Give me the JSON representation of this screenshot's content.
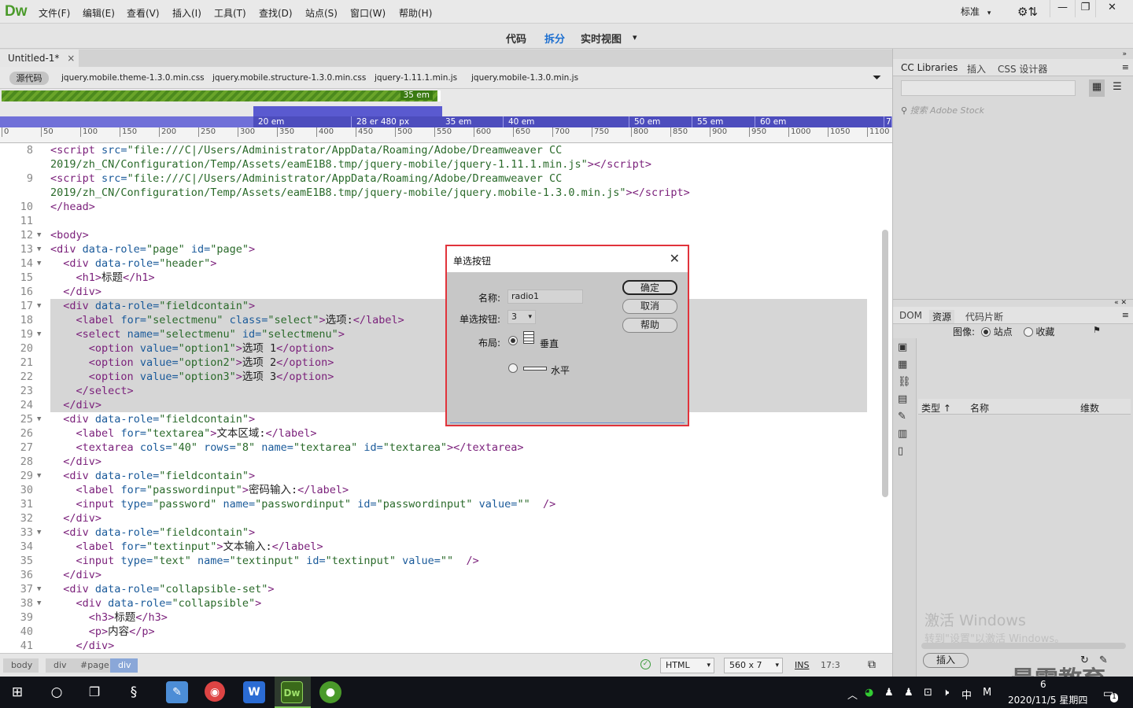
{
  "app": {
    "logo": "Dw",
    "menu": [
      "文件(F)",
      "编辑(E)",
      "查看(V)",
      "插入(I)",
      "工具(T)",
      "查找(D)",
      "站点(S)",
      "窗口(W)",
      "帮助(H)"
    ],
    "workspace": "标准",
    "workspace_caret": "▾",
    "window_minimize": "—",
    "window_restore": "❐",
    "window_close": "✕"
  },
  "view_toolbar": {
    "code": "代码",
    "split": "拆分",
    "live": "实时视图",
    "live_caret": "▾"
  },
  "document": {
    "tab_label": "Untitled-1*",
    "tab_close": "×",
    "source_button": "源代码",
    "related_files": [
      "jquery.mobile.theme-1.3.0.min.css",
      "jquery.mobile.structure-1.3.0.min.css",
      "jquery-1.11.1.min.js",
      "jquery.mobile-1.3.0.min.js"
    ]
  },
  "media_queries": {
    "green_label": "35  em",
    "row3_labels": [
      "20  em",
      "28  er 480  px",
      "35  em",
      "40  em",
      "50  em",
      "55  em",
      "60  em",
      "7"
    ],
    "ruler_ticks": [
      "0",
      "50",
      "100",
      "150",
      "200",
      "250",
      "300",
      "350",
      "400",
      "450",
      "500",
      "550",
      "600",
      "650",
      "700",
      "750",
      "800",
      "850",
      "900",
      "950",
      "1000",
      "1050",
      "1100"
    ]
  },
  "code_lines": [
    {
      "n": "8",
      "fold": "",
      "hl": false,
      "html": "<span class='tag'>&lt;script</span> <span class='attr'>src=</span><span class='val'>\"file:///C|/Users/Administrator/AppData/Roaming/Adobe/Dreamweaver CC</span>"
    },
    {
      "n": "",
      "fold": "",
      "hl": false,
      "html": "<span class='val'>2019/zh_CN/Configuration/Temp/Assets/eamE1B8.tmp/jquery-mobile/jquery-1.11.1.min.js\"</span><span class='tag'>&gt;&lt;/script&gt;</span>"
    },
    {
      "n": "9",
      "fold": "",
      "hl": false,
      "html": "<span class='tag'>&lt;script</span> <span class='attr'>src=</span><span class='val'>\"file:///C|/Users/Administrator/AppData/Roaming/Adobe/Dreamweaver CC</span>"
    },
    {
      "n": "",
      "fold": "",
      "hl": false,
      "html": "<span class='val'>2019/zh_CN/Configuration/Temp/Assets/eamE1B8.tmp/jquery-mobile/jquery.mobile-1.3.0.min.js\"</span><span class='tag'>&gt;&lt;/script&gt;</span>"
    },
    {
      "n": "10",
      "fold": "",
      "hl": false,
      "html": "<span class='tag'>&lt;/head&gt;</span>"
    },
    {
      "n": "11",
      "fold": "",
      "hl": false,
      "html": ""
    },
    {
      "n": "12",
      "fold": "▼",
      "hl": false,
      "html": "<span class='tag'>&lt;body&gt;</span>"
    },
    {
      "n": "13",
      "fold": "▼",
      "hl": false,
      "html": "<span class='tag'>&lt;div</span> <span class='attr'>data-role=</span><span class='val'>\"page\"</span> <span class='attr'>id=</span><span class='val'>\"page\"</span><span class='tag'>&gt;</span>"
    },
    {
      "n": "14",
      "fold": "▼",
      "hl": false,
      "html": "  <span class='tag'>&lt;div</span> <span class='attr'>data-role=</span><span class='val'>\"header\"</span><span class='tag'>&gt;</span>"
    },
    {
      "n": "15",
      "fold": "",
      "hl": false,
      "html": "    <span class='tag'>&lt;h1&gt;</span>标题<span class='tag'>&lt;/h1&gt;</span>"
    },
    {
      "n": "16",
      "fold": "",
      "hl": false,
      "html": "  <span class='tag'>&lt;/div&gt;</span>"
    },
    {
      "n": "17",
      "fold": "▼",
      "hl": true,
      "html": "  <span class='tag'>&lt;div</span> <span class='attr'>data-role=</span><span class='val'>\"fieldcontain\"</span><span class='tag'>&gt;</span>"
    },
    {
      "n": "18",
      "fold": "",
      "hl": true,
      "html": "    <span class='tag'>&lt;label</span> <span class='attr'>for=</span><span class='val'>\"selectmenu\"</span> <span class='attr'>class=</span><span class='val'>\"select\"</span><span class='tag'>&gt;</span>选项:<span class='tag'>&lt;/label&gt;</span>"
    },
    {
      "n": "19",
      "fold": "▼",
      "hl": true,
      "html": "    <span class='tag'>&lt;select</span> <span class='attr'>name=</span><span class='val'>\"selectmenu\"</span> <span class='attr'>id=</span><span class='val'>\"selectmenu\"</span><span class='tag'>&gt;</span>"
    },
    {
      "n": "20",
      "fold": "",
      "hl": true,
      "html": "      <span class='tag'>&lt;option</span> <span class='attr'>value=</span><span class='val'>\"option1\"</span><span class='tag'>&gt;</span>选项 1<span class='tag'>&lt;/option&gt;</span>"
    },
    {
      "n": "21",
      "fold": "",
      "hl": true,
      "html": "      <span class='tag'>&lt;option</span> <span class='attr'>value=</span><span class='val'>\"option2\"</span><span class='tag'>&gt;</span>选项 2<span class='tag'>&lt;/option&gt;</span>"
    },
    {
      "n": "22",
      "fold": "",
      "hl": true,
      "html": "      <span class='tag'>&lt;option</span> <span class='attr'>value=</span><span class='val'>\"option3\"</span><span class='tag'>&gt;</span>选项 3<span class='tag'>&lt;/option&gt;</span>"
    },
    {
      "n": "23",
      "fold": "",
      "hl": true,
      "html": "    <span class='tag'>&lt;/select&gt;</span>"
    },
    {
      "n": "24",
      "fold": "",
      "hl": true,
      "html": "  <span class='tag'>&lt;/div&gt;</span>"
    },
    {
      "n": "25",
      "fold": "▼",
      "hl": false,
      "html": "  <span class='tag'>&lt;div</span> <span class='attr'>data-role=</span><span class='val'>\"fieldcontain\"</span><span class='tag'>&gt;</span>"
    },
    {
      "n": "26",
      "fold": "",
      "hl": false,
      "html": "    <span class='tag'>&lt;label</span> <span class='attr'>for=</span><span class='val'>\"textarea\"</span><span class='tag'>&gt;</span>文本区域:<span class='tag'>&lt;/label&gt;</span>"
    },
    {
      "n": "27",
      "fold": "",
      "hl": false,
      "html": "    <span class='tag'>&lt;textarea</span> <span class='attr'>cols=</span><span class='val'>\"40\"</span> <span class='attr'>rows=</span><span class='val'>\"8\"</span> <span class='attr'>name=</span><span class='val'>\"textarea\"</span> <span class='attr'>id=</span><span class='val'>\"textarea\"</span><span class='tag'>&gt;&lt;/textarea&gt;</span>"
    },
    {
      "n": "28",
      "fold": "",
      "hl": false,
      "html": "  <span class='tag'>&lt;/div&gt;</span>"
    },
    {
      "n": "29",
      "fold": "▼",
      "hl": false,
      "html": "  <span class='tag'>&lt;div</span> <span class='attr'>data-role=</span><span class='val'>\"fieldcontain\"</span><span class='tag'>&gt;</span>"
    },
    {
      "n": "30",
      "fold": "",
      "hl": false,
      "html": "    <span class='tag'>&lt;label</span> <span class='attr'>for=</span><span class='val'>\"passwordinput\"</span><span class='tag'>&gt;</span>密码输入:<span class='tag'>&lt;/label&gt;</span>"
    },
    {
      "n": "31",
      "fold": "",
      "hl": false,
      "html": "    <span class='tag'>&lt;input</span> <span class='attr'>type=</span><span class='val'>\"password\"</span> <span class='attr'>name=</span><span class='val'>\"passwordinput\"</span> <span class='attr'>id=</span><span class='val'>\"passwordinput\"</span> <span class='attr'>value=</span><span class='val'>\"\"</span>  <span class='tag'>/&gt;</span>"
    },
    {
      "n": "32",
      "fold": "",
      "hl": false,
      "html": "  <span class='tag'>&lt;/div&gt;</span>"
    },
    {
      "n": "33",
      "fold": "▼",
      "hl": false,
      "html": "  <span class='tag'>&lt;div</span> <span class='attr'>data-role=</span><span class='val'>\"fieldcontain\"</span><span class='tag'>&gt;</span>"
    },
    {
      "n": "34",
      "fold": "",
      "hl": false,
      "html": "    <span class='tag'>&lt;label</span> <span class='attr'>for=</span><span class='val'>\"textinput\"</span><span class='tag'>&gt;</span>文本输入:<span class='tag'>&lt;/label&gt;</span>"
    },
    {
      "n": "35",
      "fold": "",
      "hl": false,
      "html": "    <span class='tag'>&lt;input</span> <span class='attr'>type=</span><span class='val'>\"text\"</span> <span class='attr'>name=</span><span class='val'>\"textinput\"</span> <span class='attr'>id=</span><span class='val'>\"textinput\"</span> <span class='attr'>value=</span><span class='val'>\"\"</span>  <span class='tag'>/&gt;</span>"
    },
    {
      "n": "36",
      "fold": "",
      "hl": false,
      "html": "  <span class='tag'>&lt;/div&gt;</span>"
    },
    {
      "n": "37",
      "fold": "▼",
      "hl": false,
      "html": "  <span class='tag'>&lt;div</span> <span class='attr'>data-role=</span><span class='val'>\"collapsible-set\"</span><span class='tag'>&gt;</span>"
    },
    {
      "n": "38",
      "fold": "▼",
      "hl": false,
      "html": "    <span class='tag'>&lt;div</span> <span class='attr'>data-role=</span><span class='val'>\"collapsible\"</span><span class='tag'>&gt;</span>"
    },
    {
      "n": "39",
      "fold": "",
      "hl": false,
      "html": "      <span class='tag'>&lt;h3&gt;</span>标题<span class='tag'>&lt;/h3&gt;</span>"
    },
    {
      "n": "40",
      "fold": "",
      "hl": false,
      "html": "      <span class='tag'>&lt;p&gt;</span>内容<span class='tag'>&lt;/p&gt;</span>"
    },
    {
      "n": "41",
      "fold": "",
      "hl": false,
      "html": "    <span class='tag'>&lt;/div&gt;</span>"
    }
  ],
  "status_bar": {
    "breadcrumbs": [
      "body",
      "div",
      "#page",
      "div"
    ],
    "language": "HTML",
    "window_size": "560 x 7",
    "insert_mode": "INS",
    "cursor_pos": "17:3"
  },
  "right_panel": {
    "top_tabs": [
      "CC Libraries",
      "插入",
      "CSS 设计器"
    ],
    "stock_search_placeholder": "搜索 Adobe Stock",
    "bottom_tabs": [
      "DOM",
      "资源",
      "代码片断"
    ],
    "image_label": "图像:",
    "site_option": "站点",
    "favorites_option": "收藏",
    "columns": [
      "类型 ↑",
      "名称",
      "维数"
    ],
    "insert_button": "插入"
  },
  "dialog": {
    "title": "单选按钮",
    "close": "✕",
    "name_label": "名称:",
    "name_value": "radio1",
    "count_label": "单选按钮:",
    "count_value": "3",
    "layout_label": "布局:",
    "vertical_label": "垂直",
    "horizontal_label": "水平",
    "ok": "确定",
    "cancel": "取消",
    "help": "帮助"
  },
  "watermark": {
    "line1": "激活 Windows",
    "line2": "转到\"设置\"以激活 Windows。",
    "brand": "最需教育"
  },
  "taskbar": {
    "tray_lang": "中",
    "tray_ime": "M",
    "clock_time": "6",
    "clock_date": "2020/11/5 星期四",
    "notif_count": "1",
    "apps": [
      "windows-start-icon",
      "cortana-icon",
      "task-view-icon",
      "app-s-icon",
      "notepad-icon",
      "chrome-icon",
      "word-icon",
      "dreamweaver-icon",
      "watermelon-icon"
    ]
  }
}
